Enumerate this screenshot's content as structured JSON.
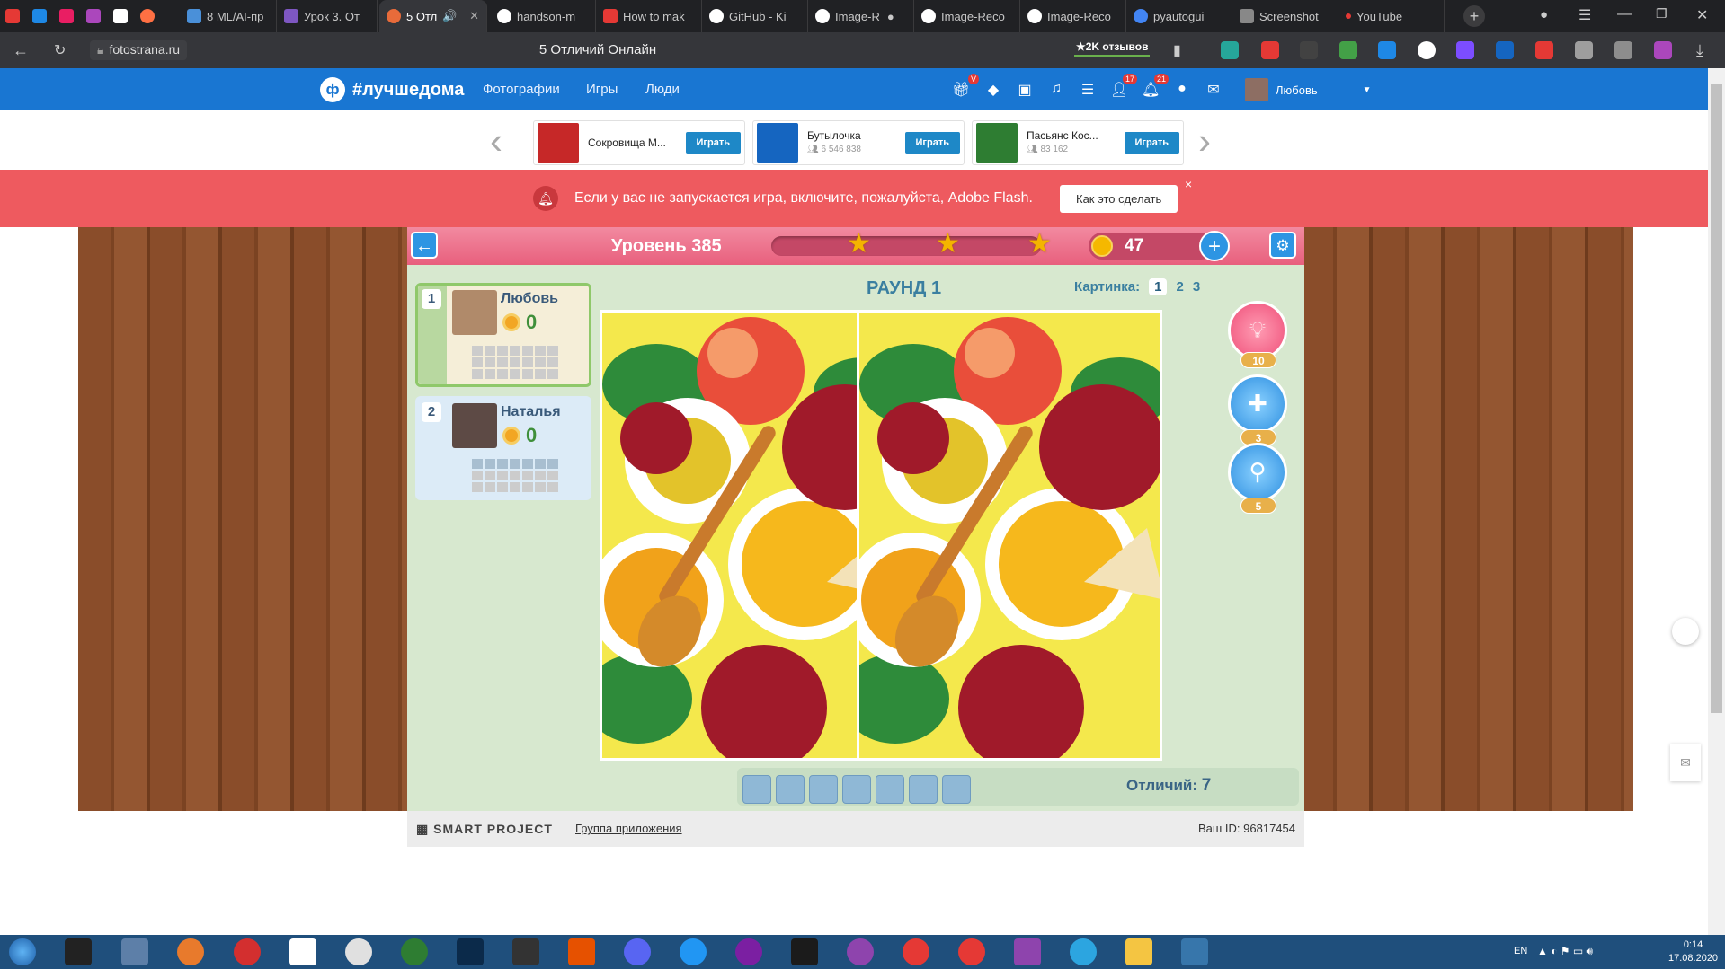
{
  "browser": {
    "tabs": [
      {
        "title": "8 ML/AI-пр",
        "color": "#4a90d9"
      },
      {
        "title": "Урок 3. От",
        "color": "#7e57c2"
      },
      {
        "title": "5 Отл",
        "color": "#e86b3a",
        "active": true
      },
      {
        "title": "handson-m",
        "color": "#ffffff"
      },
      {
        "title": "How to mak",
        "color": "#e53935"
      },
      {
        "title": "GitHub - Ki",
        "color": "#ffffff"
      },
      {
        "title": "Image-R",
        "color": "#ffffff"
      },
      {
        "title": "Image-Reco",
        "color": "#ffffff"
      },
      {
        "title": "Image-Reco",
        "color": "#ffffff"
      },
      {
        "title": "pyautogui",
        "color": "#4285f4"
      },
      {
        "title": "Screenshot",
        "color": "#888888"
      },
      {
        "title": "YouTube",
        "color": "#e53935"
      }
    ],
    "url": "fotostrana.ru",
    "page_title": "5 Отличий Онлайн",
    "reviews": "★2K отзывов"
  },
  "site": {
    "logo_text": "#лучшедома",
    "nav": [
      "Фотографии",
      "Игры",
      "Люди"
    ],
    "badges": {
      "friends": "17",
      "notifications": "21",
      "gift": "V"
    },
    "user_name": "Любовь"
  },
  "promo": {
    "cards": [
      {
        "title": "Сокровища М...",
        "count": "",
        "button": "Играть",
        "color": "#c62828"
      },
      {
        "title": "Бутылочка",
        "count": "6 546 838",
        "button": "Играть",
        "color": "#1565c0"
      },
      {
        "title": "Пасьянс Кос...",
        "count": "83 162",
        "button": "Играть",
        "color": "#2e7d32"
      }
    ]
  },
  "notice": {
    "text": "Если у вас не запускается игра, включите, пожалуйста, Adobe Flash.",
    "button": "Как это сделать",
    "close": "×"
  },
  "game": {
    "level": "Уровень 385",
    "coins": "47",
    "round": "РАУНД 1",
    "picture_label": "Картинка:",
    "pictures": [
      "1",
      "2",
      "3"
    ],
    "players": [
      {
        "num": "1",
        "name": "Любовь",
        "score": "0"
      },
      {
        "num": "2",
        "name": "Наталья",
        "score": "0"
      }
    ],
    "powerups": [
      {
        "icon": "lightbulb-icon",
        "count": "10"
      },
      {
        "icon": "bandage-icon",
        "count": "3"
      },
      {
        "icon": "magnifier-icon",
        "count": "5"
      }
    ],
    "differences_label": "Отличий:",
    "differences_count": "7"
  },
  "footer": {
    "brand": "SMART PROJECT",
    "group": "Группа приложения",
    "user_id": "Ваш ID: 96817454"
  },
  "taskbar": {
    "lang": "EN",
    "time": "0:14",
    "date": "17.08.2020"
  }
}
